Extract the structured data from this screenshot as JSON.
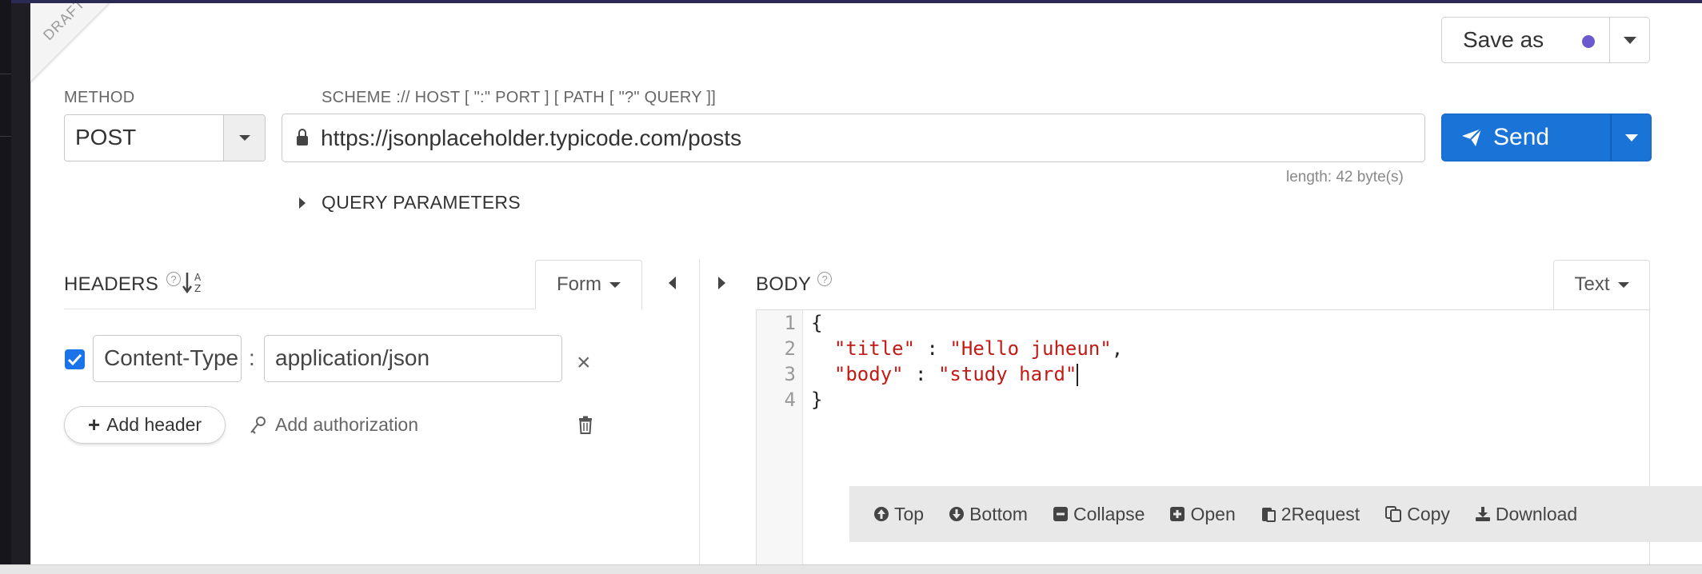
{
  "draft_label": "DRAFT",
  "save": {
    "label": "Save as",
    "dot_color": "#6a5acd"
  },
  "method": {
    "label": "METHOD",
    "value": "POST"
  },
  "url": {
    "label": "SCHEME :// HOST [ \":\" PORT ] [ PATH [ \"?\" QUERY ]]",
    "value": "https://jsonplaceholder.typicode.com/posts",
    "length": "length: 42 byte(s)"
  },
  "send": {
    "label": "Send",
    "color": "#1a73d6"
  },
  "query_params": {
    "label": "QUERY PARAMETERS"
  },
  "headers": {
    "title": "HEADERS",
    "help": "?",
    "mode": "Form",
    "rows": [
      {
        "checked": true,
        "name": "Content-Type",
        "value": "application/json"
      }
    ],
    "add_header_label": "Add header",
    "add_auth_label": "Add authorization"
  },
  "body": {
    "title": "BODY",
    "help": "?",
    "mode": "Text",
    "line_numbers": [
      "1",
      "2",
      "3",
      "4"
    ],
    "code": {
      "open": "{",
      "l2_key": "\"title\"",
      "l2_sep": " : ",
      "l2_val": "\"Hello juheun\"",
      "l2_end": ",",
      "l3_key": "\"body\"",
      "l3_sep": " : ",
      "l3_val": "\"study hard\"",
      "close": "}"
    }
  },
  "toolbar": {
    "top": "Top",
    "bottom": "Bottom",
    "collapse": "Collapse",
    "open": "Open",
    "to_request": "2Request",
    "copy": "Copy",
    "download": "Download"
  }
}
